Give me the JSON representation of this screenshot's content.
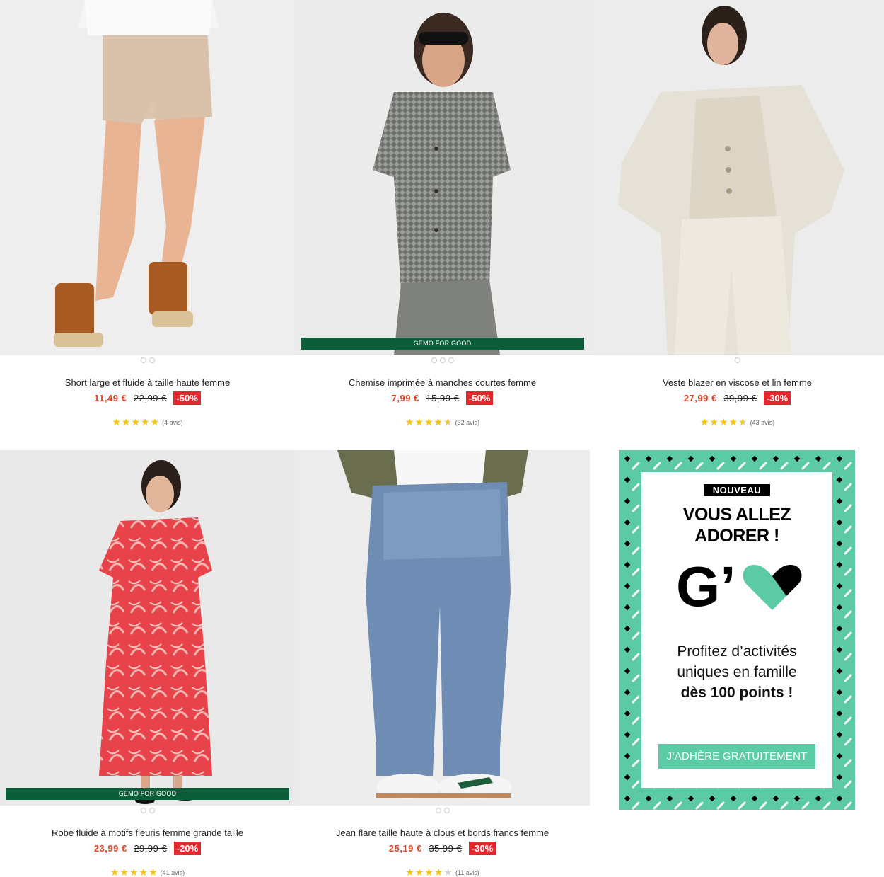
{
  "products": [
    {
      "title": "Short large et fluide à taille haute femme",
      "price": "11,49 €",
      "old_price": "22,99 €",
      "discount": "-50%",
      "rating": 5,
      "reviews": "(4 avis)",
      "badge": "",
      "dots": 2
    },
    {
      "title": "Chemise imprimée à manches courtes femme",
      "price": "7,99 €",
      "old_price": "15,99 €",
      "discount": "-50%",
      "rating": 4.5,
      "reviews": "(32 avis)",
      "badge": "GEMO FOR GOOD",
      "dots": 3
    },
    {
      "title": "Veste blazer en viscose et lin femme",
      "price": "27,99 €",
      "old_price": "39,99 €",
      "discount": "-30%",
      "rating": 4.5,
      "reviews": "(43 avis)",
      "badge": "",
      "dots": 1
    },
    {
      "title": "Robe fluide à motifs fleuris femme grande taille",
      "price": "23,99 €",
      "old_price": "29,99 €",
      "discount": "-20%",
      "rating": 5,
      "reviews": "(41 avis)",
      "badge": "GEMO FOR GOOD",
      "dots": 2
    },
    {
      "title": "Jean flare taille haute à clous et bords francs femme",
      "price": "25,19 €",
      "old_price": "35,99 €",
      "discount": "-30%",
      "rating": 4,
      "reviews": "(11 avis)",
      "badge": "",
      "dots": 2
    }
  ],
  "promo": {
    "tag": "NOUVEAU",
    "headline_line1": "VOUS ALLEZ",
    "headline_line2": "ADORER !",
    "logo_letter": "G’",
    "text_line1": "Profitez d’activités",
    "text_line2": "uniques en famille",
    "text_line3": "dès 100 points !",
    "cta": "J’ADHÈRE GRATUITEMENT"
  },
  "colors": {
    "price": "#e84124",
    "discount_bg": "#e5262d",
    "star": "#f5c30a",
    "good_badge": "#0c5e3b",
    "promo_green": "#5ccaa5"
  }
}
